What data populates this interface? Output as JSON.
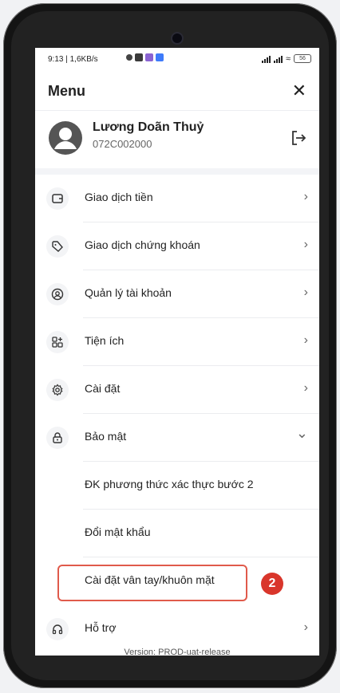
{
  "status_bar": {
    "time_speed": "9:13 | 1,6KB/s",
    "battery": "56"
  },
  "header": {
    "title": "Menu",
    "close_symbol": "✕"
  },
  "profile": {
    "name": "Lương Doãn Thuỷ",
    "account_id": "072C002000"
  },
  "menu_items": [
    {
      "label": "Giao dịch tiền",
      "icon": "wallet-icon",
      "chevron": "›"
    },
    {
      "label": "Giao dịch chứng khoán",
      "icon": "tag-icon",
      "chevron": "›"
    },
    {
      "label": "Quản lý tài khoản",
      "icon": "user-circle-icon",
      "chevron": "›"
    },
    {
      "label": "Tiện ích",
      "icon": "grid-plus-icon",
      "chevron": "›"
    },
    {
      "label": "Cài đặt",
      "icon": "gear-icon",
      "chevron": "›"
    },
    {
      "label": "Bảo mật",
      "icon": "lock-icon",
      "chevron": "⌄"
    }
  ],
  "security_submenu": [
    {
      "label": "ĐK phương thức xác thực bước 2"
    },
    {
      "label": "Đổi mật khẩu"
    },
    {
      "label": "Cài đặt vân tay/khuôn mặt"
    }
  ],
  "support_item": {
    "label": "Hỗ trợ",
    "icon": "headset-icon",
    "chevron": "›"
  },
  "annotation": {
    "step_number": "2",
    "color": "#d9362b"
  },
  "version_text": "Version: PROD-uat-release"
}
